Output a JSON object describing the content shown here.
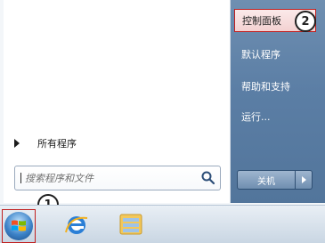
{
  "start_menu": {
    "all_programs_label": "所有程序",
    "search": {
      "placeholder": "搜索程序和文件"
    },
    "right_items": [
      {
        "label": "控制面板",
        "highlighted": true
      },
      {
        "label": "默认程序"
      },
      {
        "label": "帮助和支持"
      },
      {
        "label": "运行..."
      }
    ],
    "shutdown_label": "关机"
  },
  "annotations": {
    "badge1": "1",
    "badge2": "2"
  },
  "taskbar": {
    "pinned": [
      {
        "icon": "internet-explorer-icon"
      },
      {
        "icon": "windows-explorer-folder-icon"
      }
    ]
  },
  "colors": {
    "highlight_border": "#c01f1f",
    "right_pane": "#5b7ea5"
  }
}
